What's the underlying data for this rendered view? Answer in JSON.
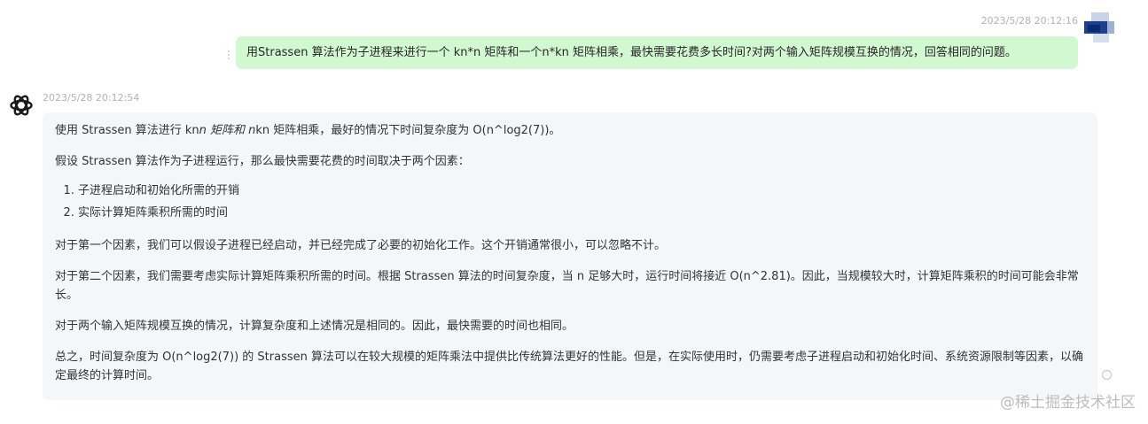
{
  "user_message": {
    "timestamp": "2023/5/28 20:12:16",
    "text": "用Strassen 算法作为子进程来进行一个 kn*n 矩阵和一个n*kn 矩阵相乘，最快需要花费多长时间?对两个输入矩阵规模互换的情况，回答相同的问题。",
    "more_icon": "more-vertical-icon",
    "avatar_icon": "user-avatar-icon"
  },
  "bot_message": {
    "timestamp": "2023/5/28 20:12:54",
    "logo_icon": "openai-logo-icon",
    "p1_before": "使用 Strassen 算法进行 kn",
    "p1_italic": "n 矩阵和 n",
    "p1_after": "kn 矩阵相乘，最好的情况下时间复杂度为 O(n^log2(7))。",
    "p2": "假设 Strassen 算法作为子进程运行，那么最快需要花费的时间取决于两个因素：",
    "list": [
      "子进程启动和初始化所需的开销",
      "实际计算矩阵乘积所需的时间"
    ],
    "p3": "对于第一个因素，我们可以假设子进程已经启动，并已经完成了必要的初始化工作。这个开销通常很小，可以忽略不计。",
    "p4": "对于第二个因素，我们需要考虑实际计算矩阵乘积所需的时间。根据 Strassen 算法的时间复杂度，当 n 足够大时，运行时间将接近 O(n^2.81)。因此，当规模较大时，计算矩阵乘积的时间可能会非常长。",
    "p5": "对于两个输入矩阵规模互换的情况，计算复杂度和上述情况是相同的。因此，最快需要的时间也相同。",
    "p6": "总之，时间复杂度为 O(n^log2(7)) 的 Strassen 算法可以在较大规模的矩阵乘法中提供比传统算法更好的性能。但是，在实际使用时，仍需要考虑子进程启动和初始化时间、系统资源限制等因素，以确定最终的计算时间。"
  },
  "side_icon": "circle-icon",
  "watermark": "@稀土掘金技术社区"
}
